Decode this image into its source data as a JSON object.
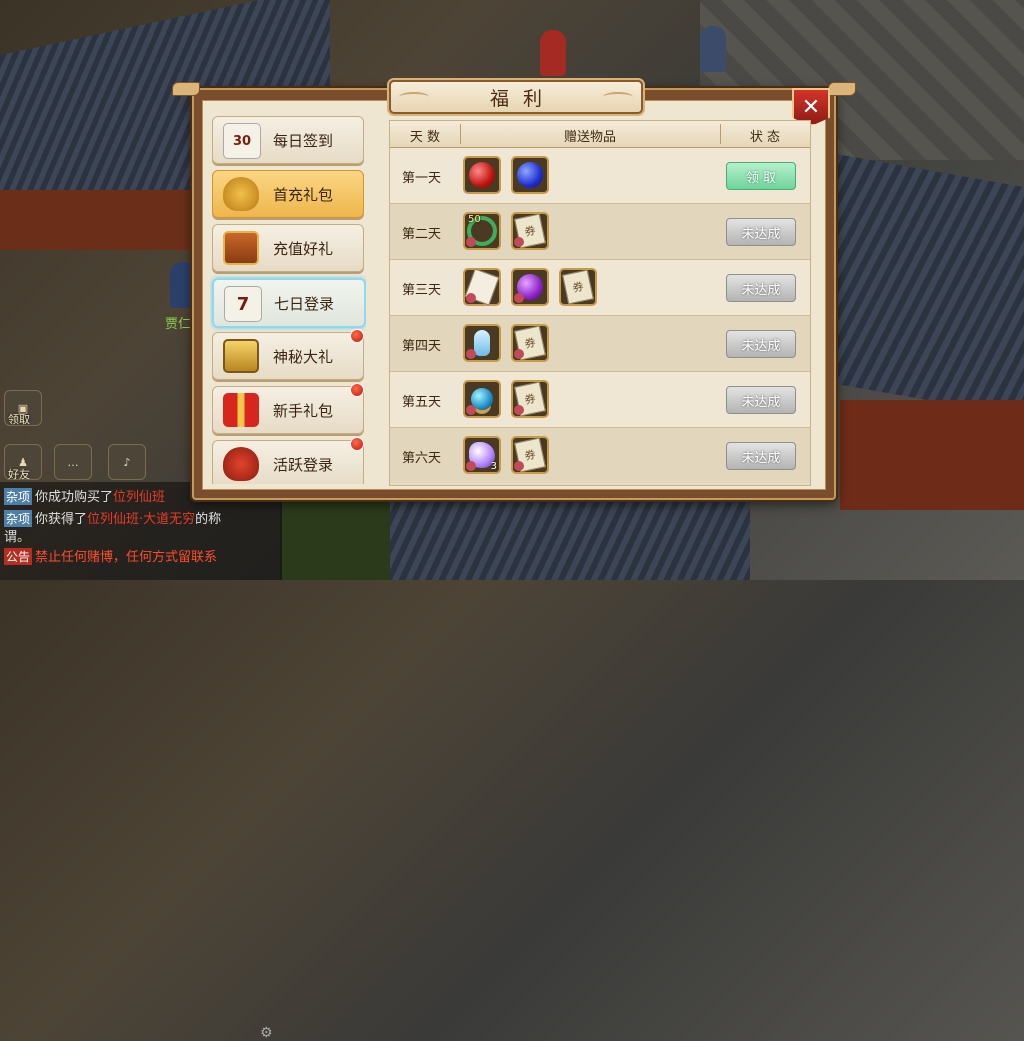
{
  "npc_name": "贾仁",
  "hud": {
    "claim_label": "领取",
    "friends_label": "好友"
  },
  "chat": [
    {
      "tag": "杂项",
      "parts": [
        "你成功购买了",
        "位列仙班",
        ""
      ]
    },
    {
      "tag": "杂项",
      "parts": [
        "你获得了",
        "位列仙班·大道无穷",
        "的称"
      ]
    },
    {
      "tag": "",
      "parts": [
        "谓。",
        "",
        ""
      ]
    },
    {
      "tag": "公告",
      "parts": [
        "",
        "禁止任何赌博，任何方式留联系",
        ""
      ]
    }
  ],
  "dialog": {
    "title": "福利",
    "close_symbol": "✕"
  },
  "sidebar": {
    "items": [
      {
        "label": "每日签到",
        "icon": "calendar-30-icon",
        "icon_text": "30",
        "state": "normal",
        "badge": false
      },
      {
        "label": "首充礼包",
        "icon": "money-bag-icon",
        "icon_text": "",
        "state": "active",
        "badge": false
      },
      {
        "label": "充值好礼",
        "icon": "treasure-chest-icon",
        "icon_text": "",
        "state": "normal",
        "badge": false
      },
      {
        "label": "七日登录",
        "icon": "calendar-7-icon",
        "icon_text": "7",
        "state": "selected",
        "badge": false
      },
      {
        "label": "神秘大礼",
        "icon": "gold-chest-icon",
        "icon_text": "",
        "state": "normal",
        "badge": true
      },
      {
        "label": "新手礼包",
        "icon": "gift-box-icon",
        "icon_text": "",
        "state": "normal",
        "badge": true
      },
      {
        "label": "活跃登录",
        "icon": "red-bag-icon",
        "icon_text": "",
        "state": "normal",
        "badge": true
      }
    ]
  },
  "table": {
    "headers": {
      "days": "天 数",
      "gifts": "赠送物品",
      "status": "状 态"
    },
    "rows": [
      {
        "day": "第一天",
        "items": [
          {
            "icon": "red-orb-icon",
            "count": ""
          },
          {
            "icon": "blue-orb-icon",
            "count": ""
          }
        ],
        "button": "领 取",
        "claimable": true
      },
      {
        "day": "第二天",
        "items": [
          {
            "icon": "green-ring-icon",
            "count": "50"
          },
          {
            "icon": "scroll-icon",
            "count": ""
          }
        ],
        "button": "未达成",
        "claimable": false
      },
      {
        "day": "第三天",
        "items": [
          {
            "icon": "paper-scroll-icon",
            "count": ""
          },
          {
            "icon": "purple-orb-icon",
            "count": ""
          },
          {
            "icon": "scroll-icon",
            "count": ""
          }
        ],
        "button": "未达成",
        "claimable": false
      },
      {
        "day": "第四天",
        "items": [
          {
            "icon": "potion-vase-icon",
            "count": ""
          },
          {
            "icon": "scroll-icon",
            "count": ""
          }
        ],
        "button": "未达成",
        "claimable": false
      },
      {
        "day": "第五天",
        "items": [
          {
            "icon": "blue-pearl-icon",
            "count": ""
          },
          {
            "icon": "scroll-icon",
            "count": ""
          }
        ],
        "button": "未达成",
        "claimable": false
      },
      {
        "day": "第六天",
        "items": [
          {
            "icon": "purple-crystal-icon",
            "count": "3"
          },
          {
            "icon": "scroll-icon",
            "count": ""
          }
        ],
        "button": "未达成",
        "claimable": false
      }
    ]
  },
  "colors": {
    "frame": "#7a4e2c",
    "panel": "#efe6d2",
    "claim_button": "#6fd39a",
    "pending_button": "#b4b4b4",
    "close_button": "#c62a20",
    "badge": "#d4231a"
  }
}
